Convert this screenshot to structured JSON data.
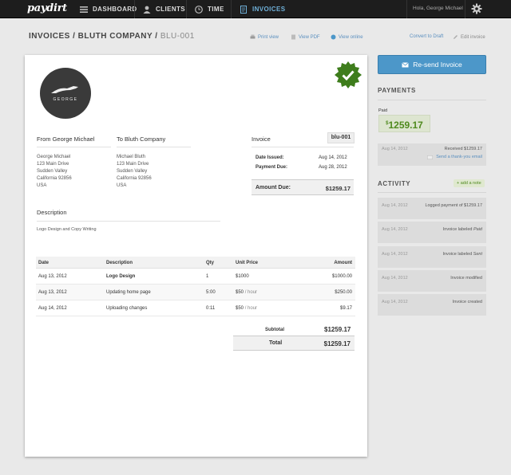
{
  "topbar": {
    "logo": "paydirt",
    "nav": [
      {
        "label": "DASHBOARD",
        "icon": "list-icon"
      },
      {
        "label": "CLIENTS",
        "icon": "person-icon"
      },
      {
        "label": "TIME",
        "icon": "clock-icon"
      },
      {
        "label": "INVOICES",
        "icon": "document-icon"
      }
    ],
    "greeting": "Hola, George Michael",
    "settings_icon": "gear-icon"
  },
  "breadcrumb": {
    "part1": "INVOICES / BLUTH COMPANY / ",
    "part2": "BLU-001"
  },
  "actions": {
    "print": "Print view",
    "pdf": "View PDF",
    "online": "View online",
    "draft": "Convert to Draft",
    "edit": "Edit invoice"
  },
  "invoice": {
    "logo_text": "GEORGE",
    "from_heading": "From George Michael",
    "to_heading": "To Bluth Company",
    "from_address": [
      "George Michael",
      "123 Main Drive",
      "Sudden Valley",
      "California 92856",
      "USA"
    ],
    "to_address": [
      "Michael Bluth",
      "123 Main Drive",
      "Sudden Valley",
      "California 92856",
      "USA"
    ],
    "invoice_label": "Invoice",
    "invoice_number": "blu-001",
    "date_issued_label": "Date Issued:",
    "date_issued": "Aug 14, 2012",
    "payment_due_label": "Payment Due:",
    "payment_due": "Aug 28, 2012",
    "amount_due_label": "Amount Due:",
    "amount_due": "$1259.17",
    "description_heading": "Description",
    "description_text": "Logo Design and Copy Writing",
    "table_headers": {
      "date": "Date",
      "description": "Description",
      "qty": "Qty",
      "unit_price": "Unit Price",
      "amount": "Amount"
    },
    "rows": [
      {
        "date": "Aug 13, 2012",
        "description": "Logo Design",
        "qty": "1",
        "price": "$1000",
        "unit": "",
        "amount": "$1000.00"
      },
      {
        "date": "Aug 13, 2012",
        "description": "Updating home page",
        "qty": "5:00",
        "price": "$50",
        "unit": "/ hour",
        "amount": "$250.00"
      },
      {
        "date": "Aug 14, 2012",
        "description": "Uploading changes",
        "qty": "0:11",
        "price": "$50",
        "unit": "/ hour",
        "amount": "$9.17"
      }
    ],
    "subtotal_label": "Subtotal",
    "subtotal": "$1259.17",
    "total_label": "Total",
    "total": "$1259.17"
  },
  "sidebar": {
    "resend_label": "Re-send Invoice",
    "payments_heading": "PAYMENTS",
    "paid_label": "Paid",
    "paid_currency": "$",
    "paid_amount": "1259.17",
    "payment_entry": {
      "date": "Aug 14, 2012",
      "text": "Received $1259.17",
      "link": "Send a thank-you email"
    },
    "activity_heading": "ACTIVITY",
    "add_note": "+ add a note",
    "activity": [
      {
        "date": "Aug 14, 2012",
        "text": "Logged payment of $1259.17",
        "emph": ""
      },
      {
        "date": "Aug 14, 2012",
        "text": "Invoice labeled ",
        "emph": "Paid"
      },
      {
        "date": "Aug 14, 2012",
        "text": "Invoice labeled ",
        "emph": "Sent"
      },
      {
        "date": "Aug 14, 2012",
        "text": "Invoice modified",
        "emph": ""
      },
      {
        "date": "Aug 14, 2012",
        "text": "Invoice created",
        "emph": ""
      }
    ]
  },
  "colors": {
    "accent": "#4c97c9",
    "paid_green": "#4f8a1e",
    "badge_green": "#3e7d1c"
  }
}
